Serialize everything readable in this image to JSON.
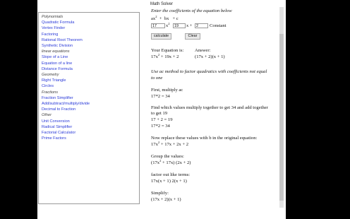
{
  "window": {
    "title": "Math Solver"
  },
  "sidebar": [
    {
      "label": "Polynomials",
      "kind": "head"
    },
    {
      "label": "Quadratic Formula",
      "kind": "link"
    },
    {
      "label": "Vertex Finder",
      "kind": "link"
    },
    {
      "label": "Factoring",
      "kind": "link"
    },
    {
      "label": "Rational Root Theorem",
      "kind": "link"
    },
    {
      "label": "Synthetic Division",
      "kind": "link"
    },
    {
      "label": "linear equations",
      "kind": "head"
    },
    {
      "label": "Slope of a Line",
      "kind": "link"
    },
    {
      "label": "Equation of a line",
      "kind": "link"
    },
    {
      "label": "Distance Formula",
      "kind": "link"
    },
    {
      "label": "Geometry",
      "kind": "head"
    },
    {
      "label": "Right Triangle",
      "kind": "link"
    },
    {
      "label": "Circles",
      "kind": "link"
    },
    {
      "label": "Fractions",
      "kind": "head"
    },
    {
      "label": "Fraction Simplifier",
      "kind": "link"
    },
    {
      "label": "Add/subtract/multiply/divide",
      "kind": "link"
    },
    {
      "label": "Decimal to Fraction",
      "kind": "link"
    },
    {
      "label": "Other",
      "kind": "head"
    },
    {
      "label": "Unit Conversion",
      "kind": "link"
    },
    {
      "label": "Radical Simplifier",
      "kind": "link"
    },
    {
      "label": "Factorial Calculator",
      "kind": "link"
    },
    {
      "label": "Prime Factors",
      "kind": "link"
    }
  ],
  "form": {
    "instruction": "Enter the coefficients of the equation below",
    "ax2": "ax",
    "sup2": "2",
    "plus1": "+",
    "bx": "bx",
    "plus2": "+",
    "c": "c",
    "a_value": "17",
    "x2_label": "x",
    "b_value": "19",
    "x_label": "x +",
    "c_value": "2",
    "constant_label": "Constant",
    "calculate_label": "calculate",
    "clear_label": "Clear"
  },
  "result": {
    "your_eq_label": "Your Equation is:",
    "your_eq_a": "17x",
    "your_eq_rest": " + 19x + 2",
    "answer_label": "Answer:",
    "answer_value": "(17x + 2)(x + 1)",
    "method_note_1": "Use ac method to factor quadratics with coefficients not equal",
    "method_note_2": "to one",
    "step1_title": "First, multiply ac",
    "step1_value": "17*2 = 34",
    "step2_line1": "Find which values multiply together to get 34 and add together",
    "step2_line2": "to get 19",
    "step2_val1": "17 + 2 = 19",
    "step2_val2": "17*2 = 34",
    "step3_title": "Now replace these values with b in the original equation:",
    "step3_a": "17x",
    "step3_rest": " + 17x + 2x + 2",
    "step4_title": "Group the values:",
    "step4_a": "(17x",
    "step4_rest": " + 17x)  (2x + 2)",
    "step5_title": "factor out like terms:",
    "step5_value": "17x(x + 1) 2(x + 1)",
    "step6_title": "Simplify:",
    "step6_value": "(17x + 2)(x + 1)"
  }
}
